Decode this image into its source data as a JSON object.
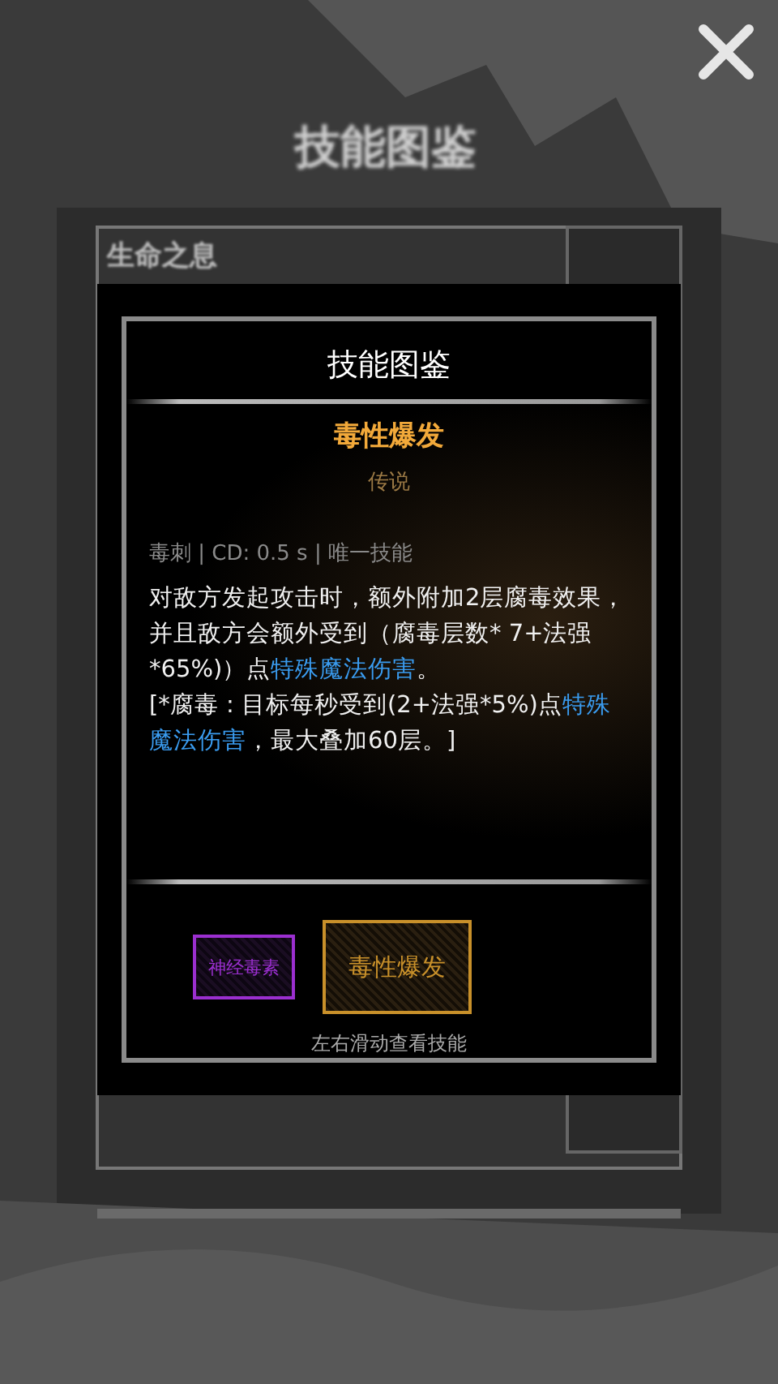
{
  "background": {
    "title": "技能图鉴",
    "entry": "生命之息"
  },
  "dialog": {
    "title": "技能图鉴",
    "skill": {
      "name": "毒性爆发",
      "rarity": "传说",
      "meta": "毒刺 | CD: 0.5 s | 唯一技能",
      "paragraphs": [
        [
          {
            "text": "对敌方发起攻击时，额外附加2层腐毒效果，并且敌方会额外受到（腐毒层数* 7+法强*65%)）点",
            "highlight": false
          },
          {
            "text": "特殊魔法伤害",
            "highlight": true
          },
          {
            "text": "。",
            "highlight": false
          }
        ],
        [
          {
            "text": "[*腐毒 : 目标每秒受到(2+法强*5%)点",
            "highlight": false
          },
          {
            "text": "特殊魔法伤害",
            "highlight": true
          },
          {
            "text": "，最大叠加60层。]",
            "highlight": false
          }
        ]
      ]
    },
    "skill_tabs": [
      {
        "label": "神经毒素",
        "color": "#9b2fd0",
        "selected": false
      },
      {
        "label": "毒性爆发",
        "color": "#c8902a",
        "selected": true
      }
    ],
    "hint": "左右滑动查看技能"
  }
}
